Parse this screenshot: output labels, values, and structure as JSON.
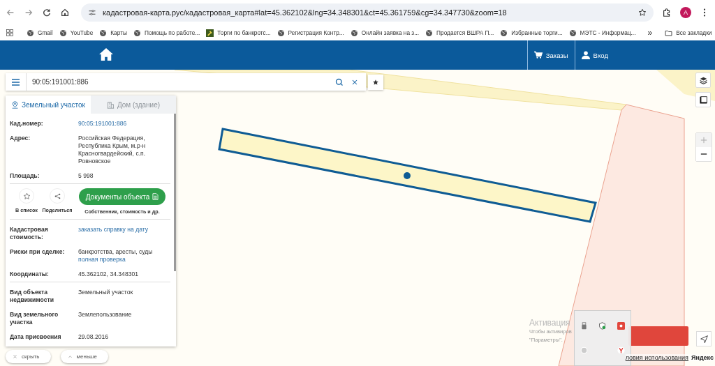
{
  "browser": {
    "url": "кадастровая-карта.рус/кадастровая_карта#lat=45.362102&lng=34.348301&ct=45.361759&cg=34.347730&zoom=18",
    "profile_initial": "A",
    "bookmarks": [
      {
        "label": "Gmail",
        "kind": "globe"
      },
      {
        "label": "YouTube",
        "kind": "globe"
      },
      {
        "label": "Карты",
        "kind": "globe"
      },
      {
        "label": "Помощь по работе...",
        "kind": "globe"
      },
      {
        "label": "Торги по банкротс...",
        "kind": "hammer"
      },
      {
        "label": "Регистрация Контр...",
        "kind": "globe"
      },
      {
        "label": "Онлайн заявка на з...",
        "kind": "globe"
      },
      {
        "label": "Продается ВШРА П...",
        "kind": "globe"
      },
      {
        "label": "Избранные торги...",
        "kind": "globe"
      },
      {
        "label": "МЭТС - Информац...",
        "kind": "globe"
      }
    ],
    "more": "»",
    "all_bookmarks": "Все закладки"
  },
  "header": {
    "nav": [
      {
        "label": "Заказы",
        "kind": "cart"
      },
      {
        "label": "Вход",
        "kind": "user"
      }
    ]
  },
  "search": {
    "value": "90:05:191001:886"
  },
  "card": {
    "tabs": [
      {
        "label": "Земельный участок",
        "kind": "land",
        "selected": true
      },
      {
        "label": "Дом (здание)",
        "kind": "house",
        "selected": false
      }
    ],
    "top_rows": [
      {
        "label": "Кад.номер:",
        "value": "90:05:191001:886",
        "value_is_link": true
      },
      {
        "label": "Адрес:",
        "value": "Российская Федерация, Республика Крым, м.р-н Красногвардейский, с.п. Ровновское",
        "value_is_link": false
      },
      {
        "label": "Площадь:",
        "value": "5 998",
        "value_is_link": false
      }
    ],
    "actions": [
      {
        "label": "В список",
        "kind": "star"
      },
      {
        "label": "Поделиться",
        "kind": "share"
      }
    ],
    "documents_button": {
      "label": "Документы объекта",
      "caption": "Собственник, стоимость и др."
    },
    "mid_rows": [
      {
        "label": "Кадастровая стоимость:",
        "value": "заказать справку на дату",
        "value_is_link": true
      },
      {
        "label": "Риски при сделке:",
        "value": "банкротства, аресты, суды",
        "value_is_link": false,
        "link": "полная проверка"
      },
      {
        "label": "Координаты:",
        "value": "45.362102, 34.348301",
        "value_is_link": false
      }
    ],
    "bottom_rows": [
      {
        "label": "Вид объекта недвижимости",
        "value": "Земельный участок",
        "value_is_link": false
      },
      {
        "label": "Вид земельного участка",
        "value": "Землепользование",
        "value_is_link": false
      },
      {
        "label": "Дата присвоения",
        "value": "29.08.2016",
        "value_is_link": false
      }
    ]
  },
  "panel_buttons": [
    {
      "label": "скрыть",
      "kind": "close"
    },
    {
      "label": "меньше",
      "kind": "collapse"
    }
  ],
  "activation": {
    "title": "Активация",
    "text": "Чтобы активиров",
    "text2": "\"Параметры\"."
  },
  "map_footer": {
    "link": "ловия использования",
    "brand": "Яндекс"
  }
}
